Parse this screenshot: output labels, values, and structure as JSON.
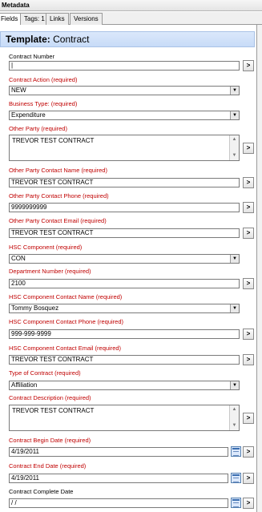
{
  "window": {
    "title": "Metadata"
  },
  "tabs": [
    {
      "label": "Fields"
    },
    {
      "label": "Tags: 1"
    },
    {
      "label": "Links"
    },
    {
      "label": "Versions"
    }
  ],
  "header": {
    "prefix": "Template:",
    "name": "Contract"
  },
  "fields": {
    "contract_number": {
      "label": "Contract Number",
      "value": "|"
    },
    "contract_action": {
      "label": "Contract Action (required)",
      "value": "NEW"
    },
    "business_type": {
      "label": "Business Type: (required)",
      "value": "Expenditure"
    },
    "other_party": {
      "label": "Other Party (required)",
      "value": "TREVOR TEST CONTRACT"
    },
    "other_party_contact_name": {
      "label": "Other Party Contact Name (required)",
      "value": "TREVOR TEST CONTRACT"
    },
    "other_party_contact_phone": {
      "label": "Other Party Contact Phone (required)",
      "value": "9999999999"
    },
    "other_party_contact_email": {
      "label": "Other Party Contact Email (required)",
      "value": "TREVOR TEST CONTRACT"
    },
    "hsc_component": {
      "label": "HSC Component (required)",
      "value": "CON"
    },
    "department_number": {
      "label": "Department Number (required)",
      "value": "2100"
    },
    "hsc_component_contact_name": {
      "label": "HSC Component Contact Name (required)",
      "value": "Tommy Bosquez"
    },
    "hsc_component_contact_phone": {
      "label": "HSC Component Contact Phone (required)",
      "value": "999-999-9999"
    },
    "hsc_component_contact_email": {
      "label": "HSC Component Contact Email (required)",
      "value": "TREVOR TEST CONTRACT"
    },
    "type_of_contract": {
      "label": "Type of Contract (required)",
      "value": "Affiliation"
    },
    "contract_description": {
      "label": "Contract Description (required)",
      "value": "TREVOR TEST CONTRACT"
    },
    "contract_begin_date": {
      "label": "Contract Begin Date (required)",
      "value": "4/19/2011"
    },
    "contract_end_date": {
      "label": "Contract End Date (required)",
      "value": "4/19/2011"
    },
    "contract_complete_date": {
      "label": "Contract Complete Date",
      "value": " /  /"
    }
  },
  "buttons": {
    "browse_label": ">"
  },
  "icons": {
    "dropdown": "chevron-down-icon",
    "calendar": "calendar-icon",
    "scroll_up": "scroll-up-icon",
    "scroll_down": "scroll-down-icon"
  },
  "colors": {
    "required_label": "#c00000",
    "header_bg": "#c7dbf7"
  }
}
